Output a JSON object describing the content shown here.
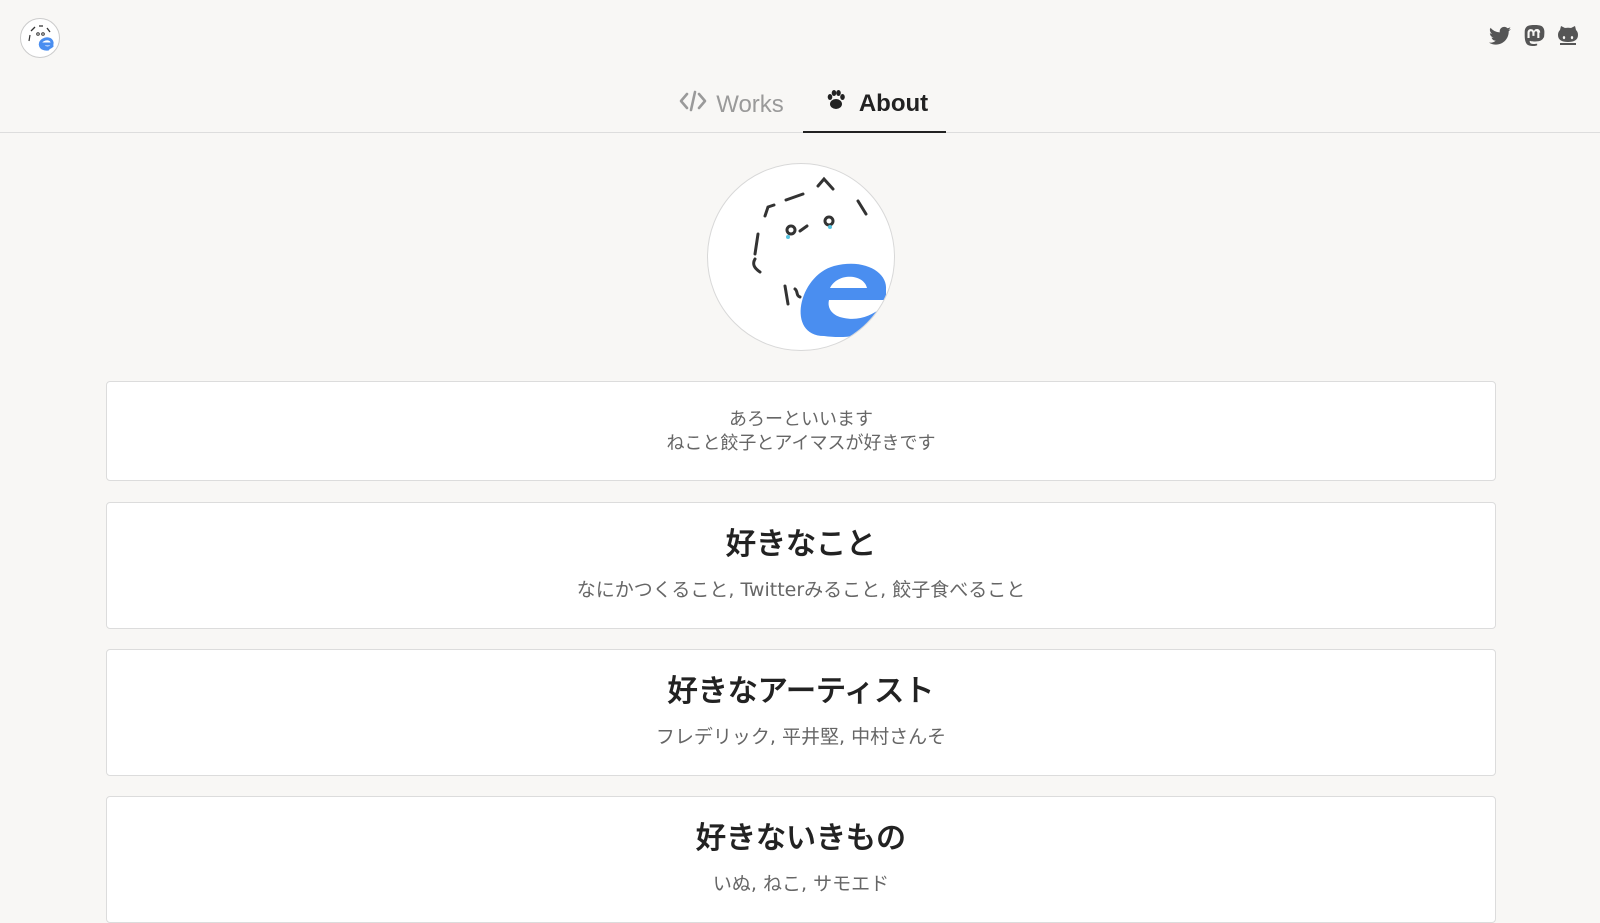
{
  "header": {
    "logo_icon": "cat-with-edge-logo-icon",
    "social": [
      {
        "name": "twitter-icon"
      },
      {
        "name": "mastodon-icon"
      },
      {
        "name": "github-icon"
      }
    ]
  },
  "tabs": [
    {
      "label": "Works",
      "icon": "code-icon",
      "active": false
    },
    {
      "label": "About",
      "icon": "paw-icon",
      "active": true
    }
  ],
  "profile": {
    "avatar_icon": "cat-with-edge-avatar-icon",
    "intro_line1": "あろーといいます",
    "intro_line2": "ねこと餃子とアイマスが好きです"
  },
  "sections": [
    {
      "title": "好きなこと",
      "body": "なにかつくること, Twitterみること, 餃子食べること"
    },
    {
      "title": "好きなアーティスト",
      "body": "フレデリック, 平井堅, 中村さんそ"
    },
    {
      "title": "好きないきもの",
      "body": "いぬ, ねこ, サモエド"
    }
  ],
  "colors": {
    "background": "#f8f7f5",
    "edge_blue": "#4a8ef0",
    "muted_text": "#666666"
  }
}
